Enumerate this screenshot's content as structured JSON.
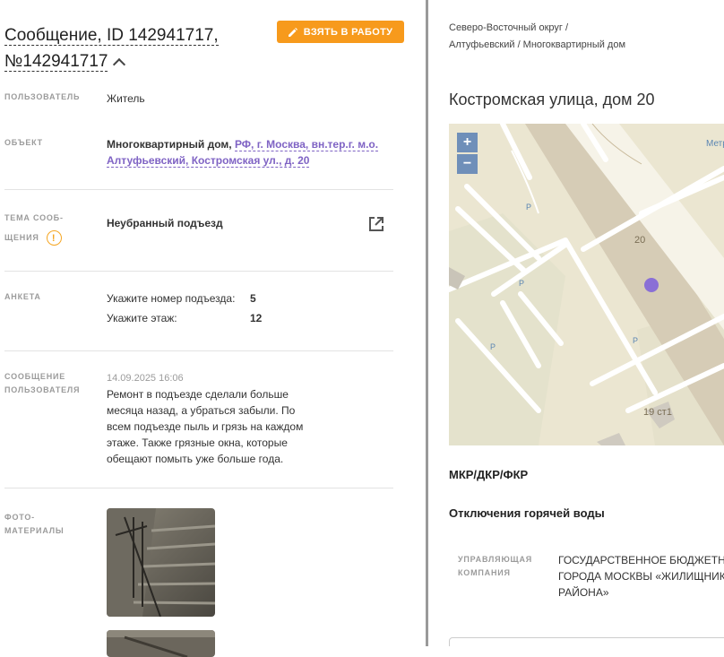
{
  "message": {
    "title": "Сообщение, ID 142941717,",
    "number": "№142941717",
    "take_button": "ВЗЯТЬ В РАБОТУ"
  },
  "fields": {
    "user_label": "ПОЛЬЗОВАТЕЛЬ",
    "user_value": "Житель",
    "object_label": "ОБЪЕКТ",
    "object_type": "Многоквартирный дом,",
    "object_address": "РФ, г. Москва, вн.тер.г. м.о. Алтуфьевский, Костромская ул., д. 20",
    "topic_label_1": "ТЕМА СООБ-",
    "topic_label_2": "ЩЕНИЯ",
    "topic_value": "Неубранный подъезд",
    "survey_label": "АНКЕТА",
    "survey": [
      {
        "q": "Укажите номер подъезда:",
        "a": "5"
      },
      {
        "q": "Укажите этаж:",
        "a": "12"
      }
    ],
    "user_msg_label_1": "СООБЩЕНИЕ",
    "user_msg_label_2": "ПОЛЬЗОВАТЕЛЯ",
    "user_msg_date": "14.09.2025 16:06",
    "user_msg_text": "Ремонт в подъезде сделали больше месяца назад, а убраться забыли. По всем подъезде пыль и грязь на каждом этаже. Также грязные окна, которые обещают помыть уже больше года.",
    "photo_label_1": "ФОТО-",
    "photo_label_2": "МАТЕРИАЛЫ"
  },
  "right": {
    "breadcrumb": "Северо-Восточный округ / Алтуфьевский / Многоквартирный дом",
    "address": "Костромская улица, дом 20",
    "map": {
      "zoom_in": "+",
      "zoom_out": "−",
      "label_building": "20",
      "label_building2": "19 ст1",
      "label_metro": "Метр",
      "parking": "P"
    },
    "section1": "МКР/ДКР/ФКР",
    "section2": "Отключения горячей воды",
    "mgmt_label": "УПРАВЛЯЮЩАЯ КОМПАНИЯ",
    "mgmt_value_1": "ГОСУДАРСТВЕННОЕ БЮДЖЕТНОЕ",
    "mgmt_value_2": "ГОРОДА МОСКВЫ «ЖИЛИЩНИК",
    "mgmt_value_3": "РАЙОНА»"
  },
  "colors": {
    "accent": "#f79a1c",
    "link": "#7f63c4",
    "marker": "#8a6fd6"
  }
}
